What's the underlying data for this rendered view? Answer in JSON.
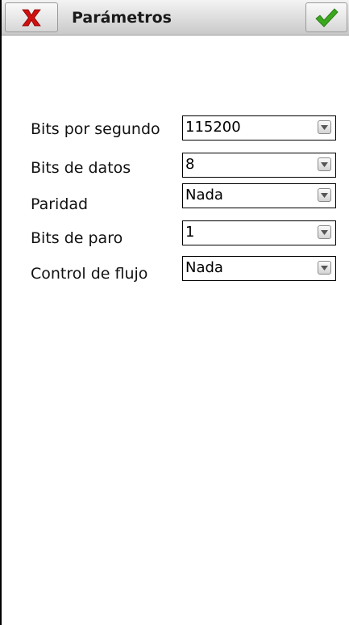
{
  "header": {
    "title": "Parámetros",
    "close_icon": "close-x-icon",
    "confirm_icon": "checkmark-icon"
  },
  "form": {
    "rows": [
      {
        "label": "Bits por segundo",
        "value": "115200"
      },
      {
        "label": "Bits de datos",
        "value": "8"
      },
      {
        "label": "Paridad",
        "value": "Nada"
      },
      {
        "label": "Bits de paro",
        "value": "1"
      },
      {
        "label": "Control de flujo",
        "value": "Nada"
      }
    ]
  },
  "colors": {
    "close_red": "#d01010",
    "check_green": "#3aa81c",
    "titlebar": "#d8d8d8"
  }
}
